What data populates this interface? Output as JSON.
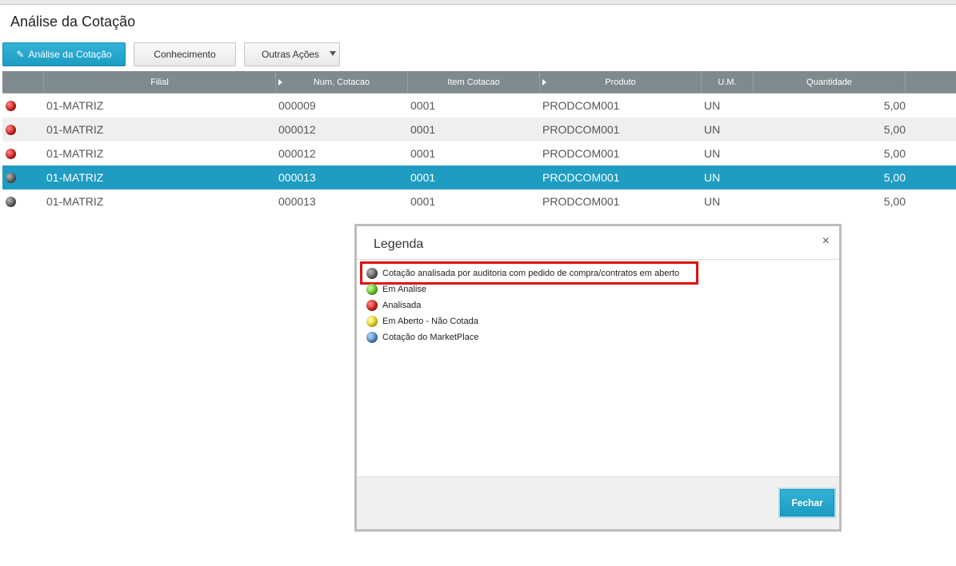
{
  "page": {
    "title": "Análise da Cotação"
  },
  "toolbar": {
    "analise_label": "Análise da Cotação",
    "conhecimento_label": "Conhecimento",
    "outras_label": "Outras Ações"
  },
  "grid": {
    "columns": [
      "",
      "Filial",
      "Num. Cotacao",
      "Item Cotacao",
      "Produto",
      "U.M.",
      "Quantidade",
      ""
    ],
    "rows": [
      {
        "status": "red",
        "filial": "01-MATRIZ",
        "num": "000009",
        "item": "0001",
        "produto": "PRODCOM001",
        "um": "UN",
        "qtd": "5,00"
      },
      {
        "status": "red",
        "filial": "01-MATRIZ",
        "num": "000012",
        "item": "0001",
        "produto": "PRODCOM001",
        "um": "UN",
        "qtd": "5,00"
      },
      {
        "status": "red",
        "filial": "01-MATRIZ",
        "num": "000012",
        "item": "0001",
        "produto": "PRODCOM001",
        "um": "UN",
        "qtd": "5,00"
      },
      {
        "status": "grey",
        "filial": "01-MATRIZ",
        "num": "000013",
        "item": "0001",
        "produto": "PRODCOM001",
        "um": "UN",
        "qtd": "5,00",
        "selected": true
      },
      {
        "status": "grey",
        "filial": "01-MATRIZ",
        "num": "000013",
        "item": "0001",
        "produto": "PRODCOM001",
        "um": "UN",
        "qtd": "5,00"
      }
    ]
  },
  "legend": {
    "title": "Legenda",
    "close_symbol": "×",
    "items": [
      {
        "color": "grey",
        "label": "Cotação analisada por auditoria com pedido de compra/contratos em aberto"
      },
      {
        "color": "green",
        "label": "Em Analise"
      },
      {
        "color": "red",
        "label": "Analisada"
      },
      {
        "color": "yellow",
        "label": "Em Aberto - Não Cotada"
      },
      {
        "color": "blue",
        "label": "Cotação do MarketPlace"
      }
    ],
    "close_label": "Fechar"
  }
}
